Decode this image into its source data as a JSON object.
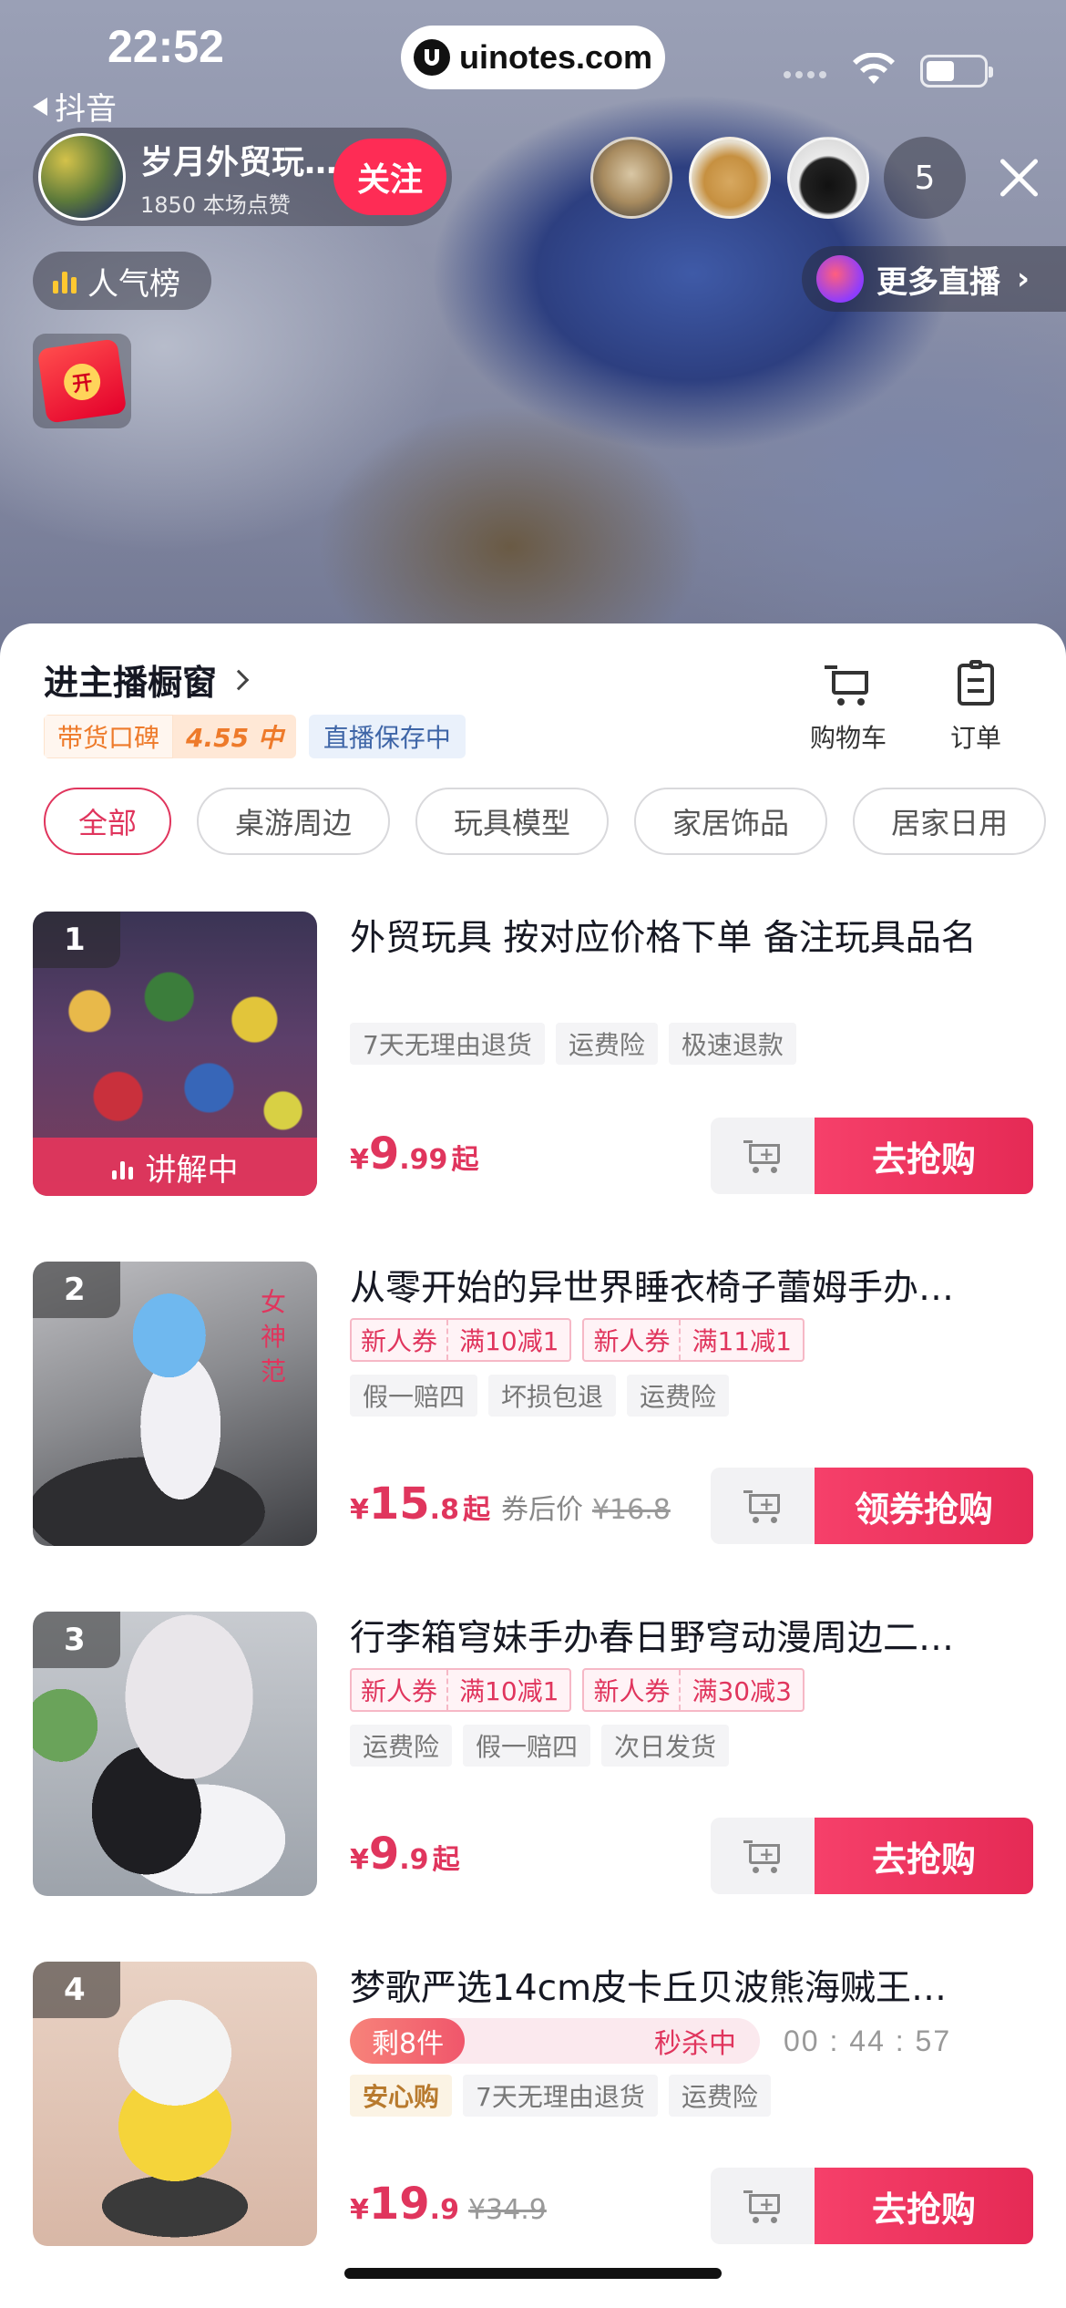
{
  "status": {
    "time": "22:52",
    "back_app": "抖音",
    "url": "uinotes.com"
  },
  "live": {
    "anchor_name": "岁月外贸玩…",
    "likes": "1850 本场点赞",
    "follow_label": "关注",
    "viewer_count": "5",
    "rank_label": "人气榜",
    "more_live_label": "更多直播",
    "redpacket_char": "开"
  },
  "shop": {
    "title": "进主播橱窗",
    "reputation_label": "带货口碑",
    "reputation_value": "4.55 中",
    "save_label": "直播保存中",
    "cart_label": "购物车",
    "order_label": "订单",
    "categories": [
      "全部",
      "桌游周边",
      "玩具模型",
      "家居饰品",
      "居家日用"
    ]
  },
  "products": [
    {
      "rank": "1",
      "title": "外贸玩具  按对应价格下单  备注玩具品名",
      "tags": [
        "7天无理由退货",
        "运费险",
        "极速退款"
      ],
      "price_cur": "¥",
      "price_int": "9",
      "price_dec": ".99",
      "price_suffix": "起",
      "explaining_label": "讲解中",
      "button": "去抢购"
    },
    {
      "rank": "2",
      "title": "从零开始的异世界睡衣椅子蕾姆手办…",
      "coupons": [
        {
          "a": "新人券",
          "b": "满10减1"
        },
        {
          "a": "新人券",
          "b": "满11减1"
        }
      ],
      "tags": [
        "假一赔四",
        "坏损包退",
        "运费险"
      ],
      "price_cur": "¥",
      "price_int": "15",
      "price_dec": ".8",
      "price_suffix": "起",
      "after_coupon": "券后价",
      "original": "¥16.8",
      "thumb_text": "女神范",
      "button": "领券抢购"
    },
    {
      "rank": "3",
      "title": "行李箱穹妹手办春日野穹动漫周边二…",
      "coupons": [
        {
          "a": "新人券",
          "b": "满10减1"
        },
        {
          "a": "新人券",
          "b": "满30减3"
        }
      ],
      "tags": [
        "运费险",
        "假一赔四",
        "次日发货"
      ],
      "price_cur": "¥",
      "price_int": "9",
      "price_dec": ".9",
      "price_suffix": "起",
      "button": "去抢购"
    },
    {
      "rank": "4",
      "title": "梦歌严选14cm皮卡丘贝波熊海贼王…",
      "flash_left": "剩8件",
      "flash_right": "秒杀中",
      "flash_progress": 0.28,
      "countdown": "00 : 44 : 57",
      "tags": [
        "安心购",
        "7天无理由退货",
        "运费险"
      ],
      "price_cur": "¥",
      "price_int": "19",
      "price_dec": ".9",
      "original": "¥34.9",
      "button": "去抢购"
    }
  ],
  "colors": {
    "accent": "#e0355d",
    "follow": "#fe2c55",
    "reputation": "#ee7a2a"
  }
}
